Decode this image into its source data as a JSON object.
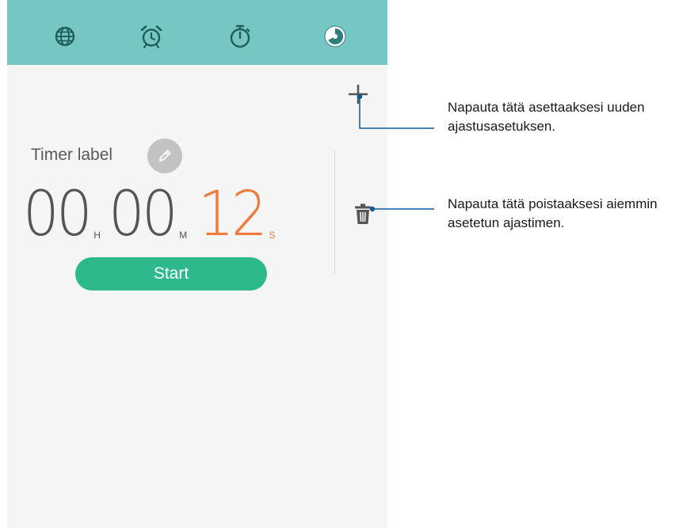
{
  "status_bar": {
    "left": "",
    "right": ""
  },
  "tabs": [
    {
      "name": "world-clock",
      "icon": "globe-icon",
      "active": false
    },
    {
      "name": "alarm",
      "icon": "alarm-clock-icon",
      "active": false
    },
    {
      "name": "stopwatch",
      "icon": "stopwatch-icon",
      "active": false
    },
    {
      "name": "timer",
      "icon": "timer-icon",
      "active": true
    }
  ],
  "timer": {
    "label": "Timer label",
    "hours": "00",
    "hours_unit": "H",
    "minutes": "00",
    "minutes_unit": "M",
    "seconds": "12",
    "seconds_unit": "S",
    "start_label": "Start"
  },
  "callouts": {
    "add": "Napauta tätä asettaaksesi uuden ajastusasetuksen.",
    "delete": "Napauta tätä poistaaksesi aiemmin asetetun ajastimen."
  },
  "colors": {
    "header": "#76c6c4",
    "accent_seconds": "#ee7b3a",
    "start_button": "#2eb98d",
    "callout_line": "#0f5a96"
  }
}
